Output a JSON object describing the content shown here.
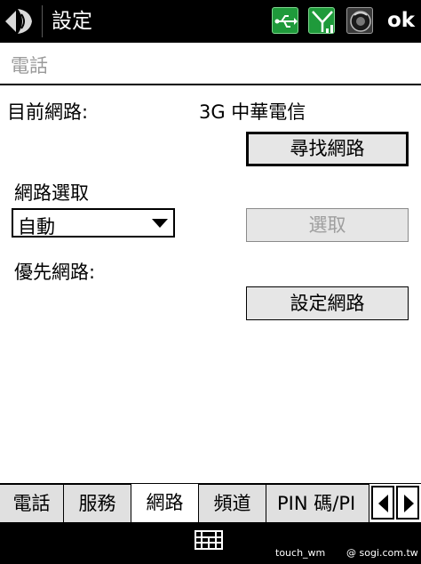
{
  "titlebar": {
    "title": "設定",
    "ok_label": "ok",
    "icons": [
      "start-icon",
      "usb-icon",
      "signal-icon",
      "volume-icon"
    ]
  },
  "section": {
    "title": "電話"
  },
  "network": {
    "current_label": "目前網路:",
    "current_value": "3G 中華電信",
    "find_button": "尋找網路",
    "mode_label": "網路選取",
    "mode_value": "自動",
    "select_button": "選取",
    "pref_label": "優先網路:",
    "pref_button": "設定網路"
  },
  "tabs": [
    {
      "label": "電話"
    },
    {
      "label": "服務"
    },
    {
      "label": "網路",
      "active": true
    },
    {
      "label": "頻道"
    },
    {
      "label": "PIN 碼/PI"
    }
  ],
  "softbar": {
    "watermark_left": "touch_wm",
    "watermark_right": "@ sogi.com.tw"
  },
  "colors": {
    "titlebar_bg": "#000000",
    "tray_green": "#1f9a3b",
    "button_bg": "#e6e6e6",
    "disabled_text": "#9e9e9e"
  }
}
